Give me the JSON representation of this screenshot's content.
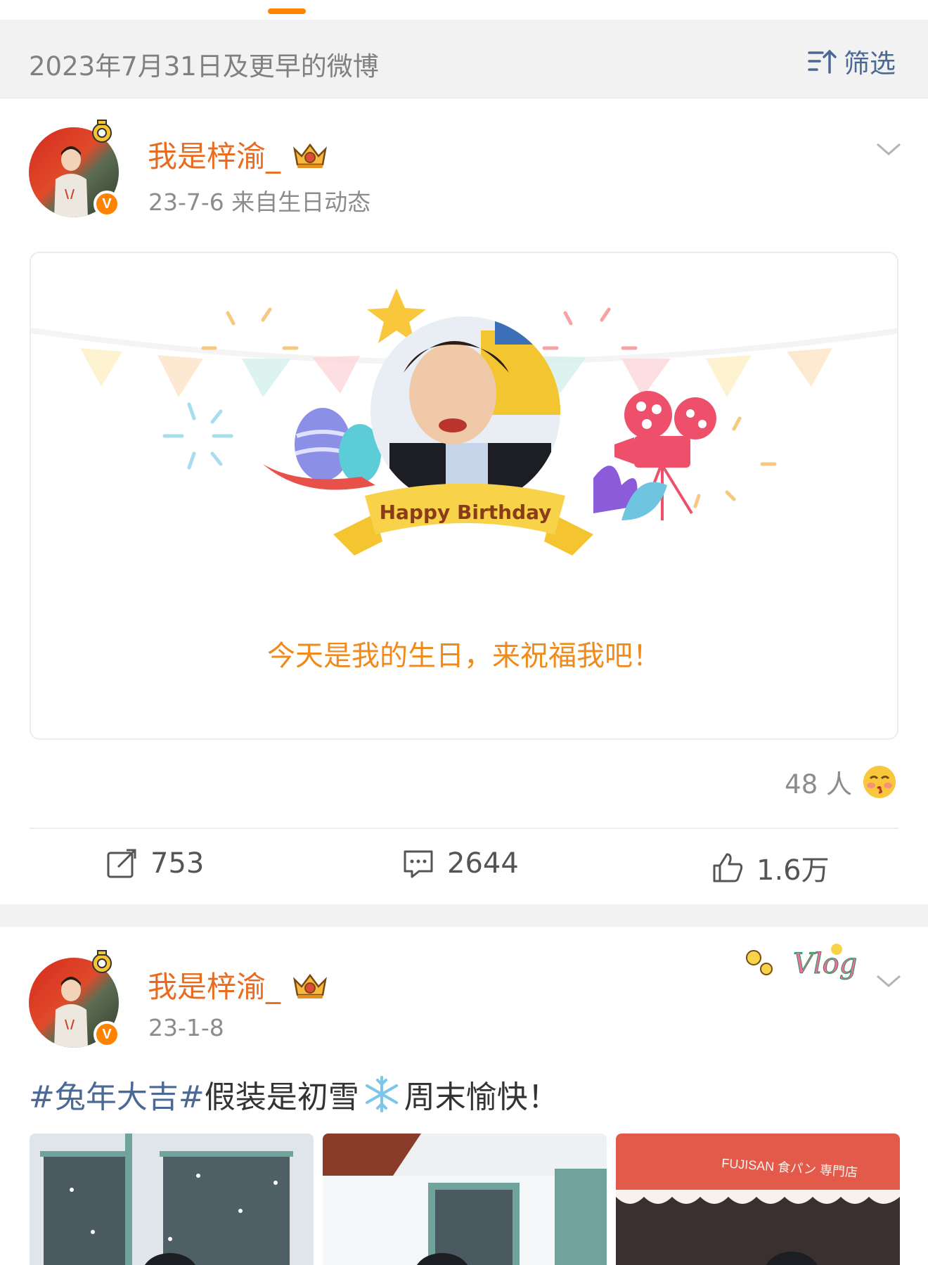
{
  "filter_bar": {
    "date_label": "2023年7月31日及更早的微博",
    "filter_label": "筛选",
    "icon": "filter-sort-icon"
  },
  "post1": {
    "username": "我是梓渝_",
    "meta": "23-7-6  来自生日动态",
    "birthday_card": {
      "banner_text": "Happy Birthday",
      "message": "今天是我的生日，来祝福我吧！"
    },
    "reactions": {
      "count_label": "48 人",
      "icon": "kiss-emoji-icon"
    },
    "actions": {
      "repost_count": "753",
      "comment_count": "2644",
      "like_count": "1.6万"
    }
  },
  "post2": {
    "username": "我是梓渝_",
    "meta": "23-1-8",
    "text": {
      "hashtag": "#兔年大吉#",
      "before_emoji": " 假装是初雪",
      "emoji": "snowflake-icon",
      "after_emoji": "周末愉快！"
    },
    "photo3_sign": "FUJISAN 食パン 専門店",
    "sticker_label": "Vlog"
  },
  "colors": {
    "accent": "#ff8200",
    "username": "#e86b1f",
    "link": "#4a6a95",
    "muted": "#8c8c8c"
  }
}
